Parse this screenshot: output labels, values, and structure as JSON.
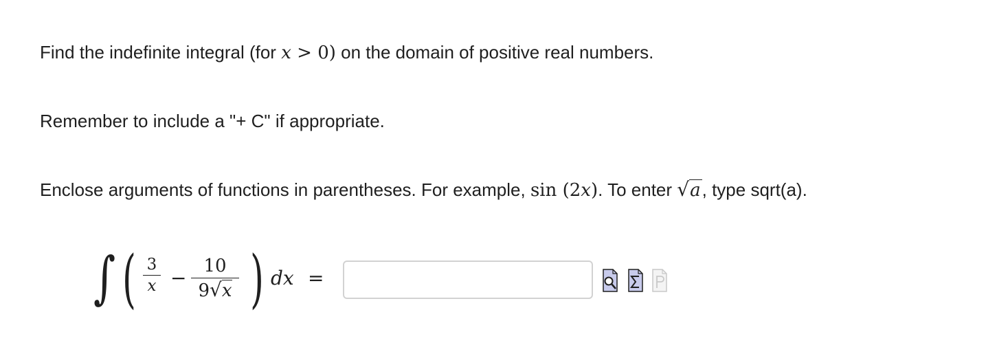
{
  "instructions": {
    "line1_before": "Find the indefinite integral (for ",
    "line1_math": "0)",
    "line1_after": " on the domain of positive real numbers.",
    "line2": "Remember to include a \"+ C\" if appropriate.",
    "line3_before": "Enclose arguments of functions in parentheses. For example, ",
    "line3_math_fn": "sin",
    "line3_mid": ". To enter ",
    "line3_after": ", type sqrt(a)."
  },
  "problem": {
    "frac1_num": "3",
    "frac1_den": "x",
    "frac2_num": "10",
    "frac2_den_coef": "9",
    "frac2_den_var": "x",
    "differential": "dx",
    "equals": "="
  },
  "answer": {
    "value": "",
    "placeholder": ""
  },
  "toolbar": {
    "icons": [
      "preview-icon",
      "equation-editor-icon",
      "paste-icon"
    ],
    "accent_color": "#3c3cb4",
    "disabled_color": "#c8c8c8"
  }
}
